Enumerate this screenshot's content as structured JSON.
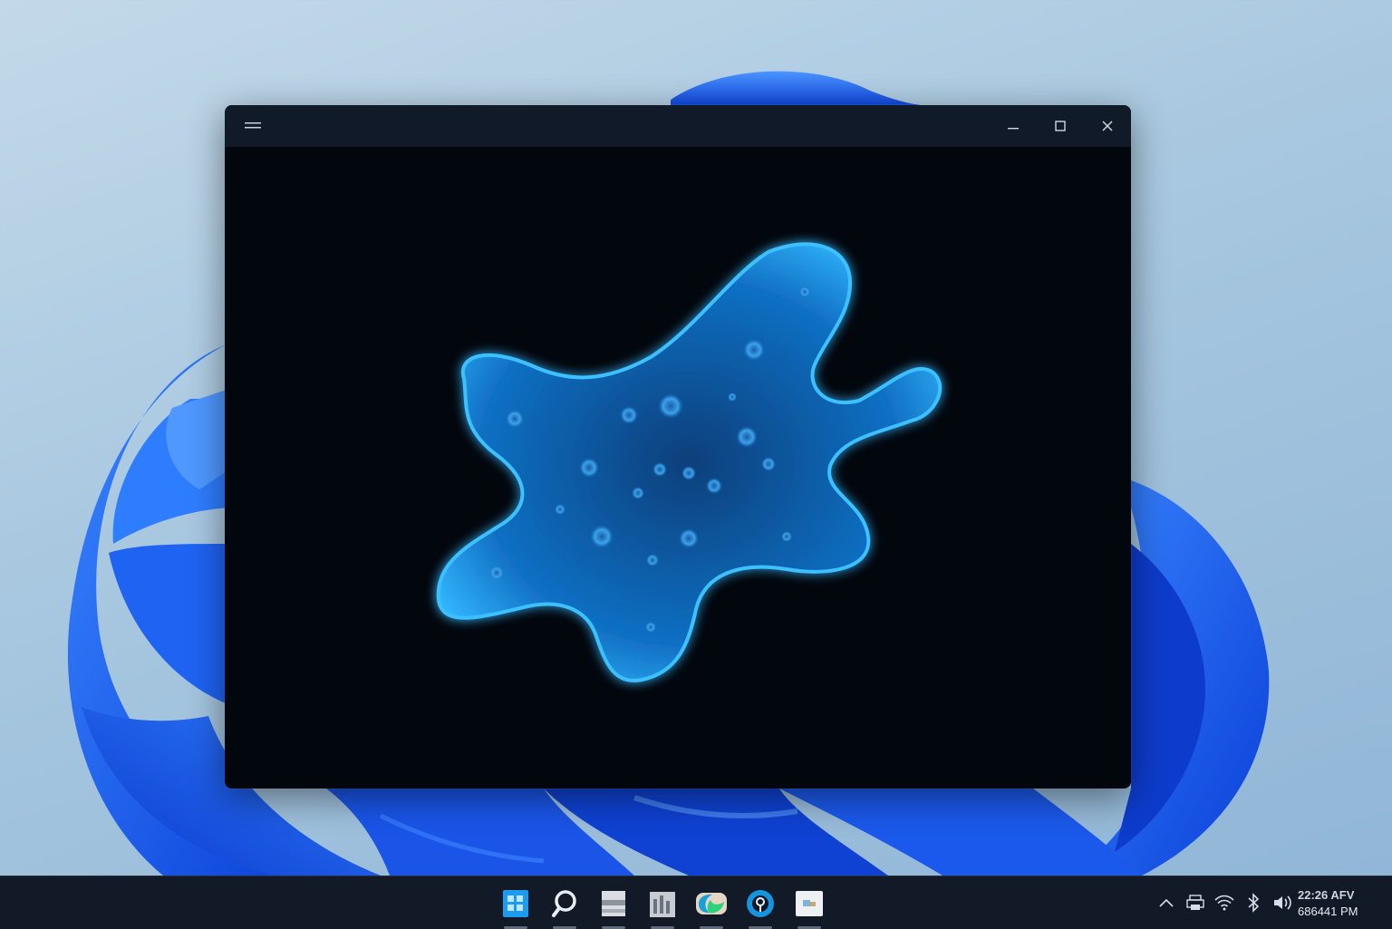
{
  "window": {
    "menu_icon": "hamburger-menu-icon",
    "minimize_icon": "minimize-icon",
    "maximize_icon": "maximize-icon",
    "close_icon": "close-icon",
    "content_image": "glowing blue amoeba-like cell on black background"
  },
  "taskbar": {
    "apps": [
      {
        "name": "start-button",
        "icon": "windows-start-icon"
      },
      {
        "name": "search-button",
        "icon": "search-icon"
      },
      {
        "name": "file-explorer-button",
        "icon": "file-explorer-icon"
      },
      {
        "name": "document-app-button",
        "icon": "document-icon"
      },
      {
        "name": "edge-browser-button",
        "icon": "edge-browser-icon"
      },
      {
        "name": "media-app-button",
        "icon": "media-app-icon"
      },
      {
        "name": "photos-app-button",
        "icon": "photos-icon"
      }
    ],
    "tray": {
      "icons": [
        "chevron-up-icon",
        "printer-icon",
        "wifi-icon",
        "bluetooth-icon",
        "volume-icon"
      ]
    },
    "clock": {
      "time": "22:26 AFV",
      "date": "686441 PM"
    }
  },
  "colors": {
    "accent": "#1f6bff",
    "titlebar": "#101a28",
    "taskbar": "#121a27",
    "window_content": "#02060d",
    "cell_glow": "#2fb4ff"
  }
}
